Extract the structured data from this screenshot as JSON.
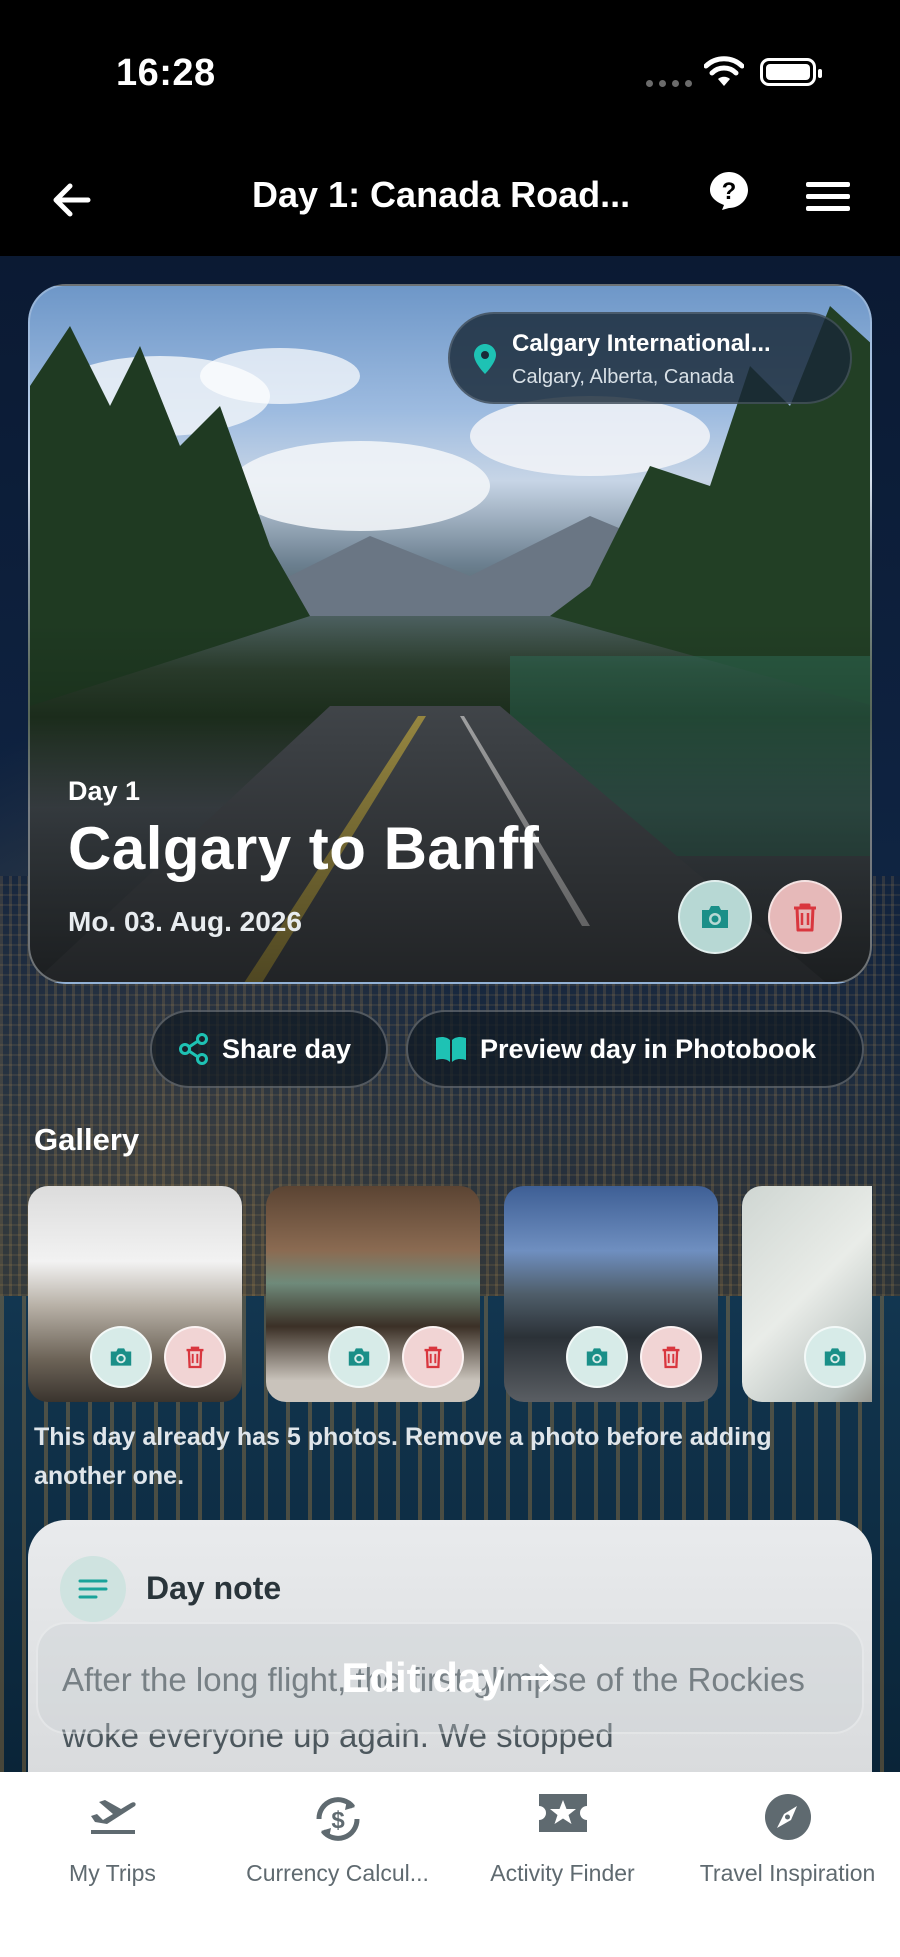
{
  "status_bar": {
    "time": "16:28"
  },
  "header": {
    "title": "Day 1: Canada Road..."
  },
  "hero": {
    "location_name": "Calgary International...",
    "location_sub": "Calgary, Alberta, Canada",
    "day_label": "Day 1",
    "day_title": "Calgary to Banff",
    "date": "Mo. 03. Aug. 2026"
  },
  "actions": {
    "share_label": "Share day",
    "photobook_label": "Preview day in Photobook"
  },
  "gallery": {
    "heading": "Gallery",
    "notice": "This day already has 5 photos. Remove a photo before adding another one."
  },
  "note": {
    "heading": "Day note",
    "text": "After the long flight, the first glimpse of the Rockies woke everyone up again. We stopped"
  },
  "edit_day_label": "Edit day",
  "bottom_nav": {
    "items": [
      {
        "label": "My Trips",
        "icon": "airplane-departure-icon"
      },
      {
        "label": "Currency Calcul...",
        "icon": "currency-exchange-icon"
      },
      {
        "label": "Activity Finder",
        "icon": "star-ticket-icon"
      },
      {
        "label": "Travel Inspiration",
        "icon": "compass-icon"
      }
    ]
  },
  "colors": {
    "accent_teal": "#1aa39a",
    "delete_red": "#d9363e"
  }
}
